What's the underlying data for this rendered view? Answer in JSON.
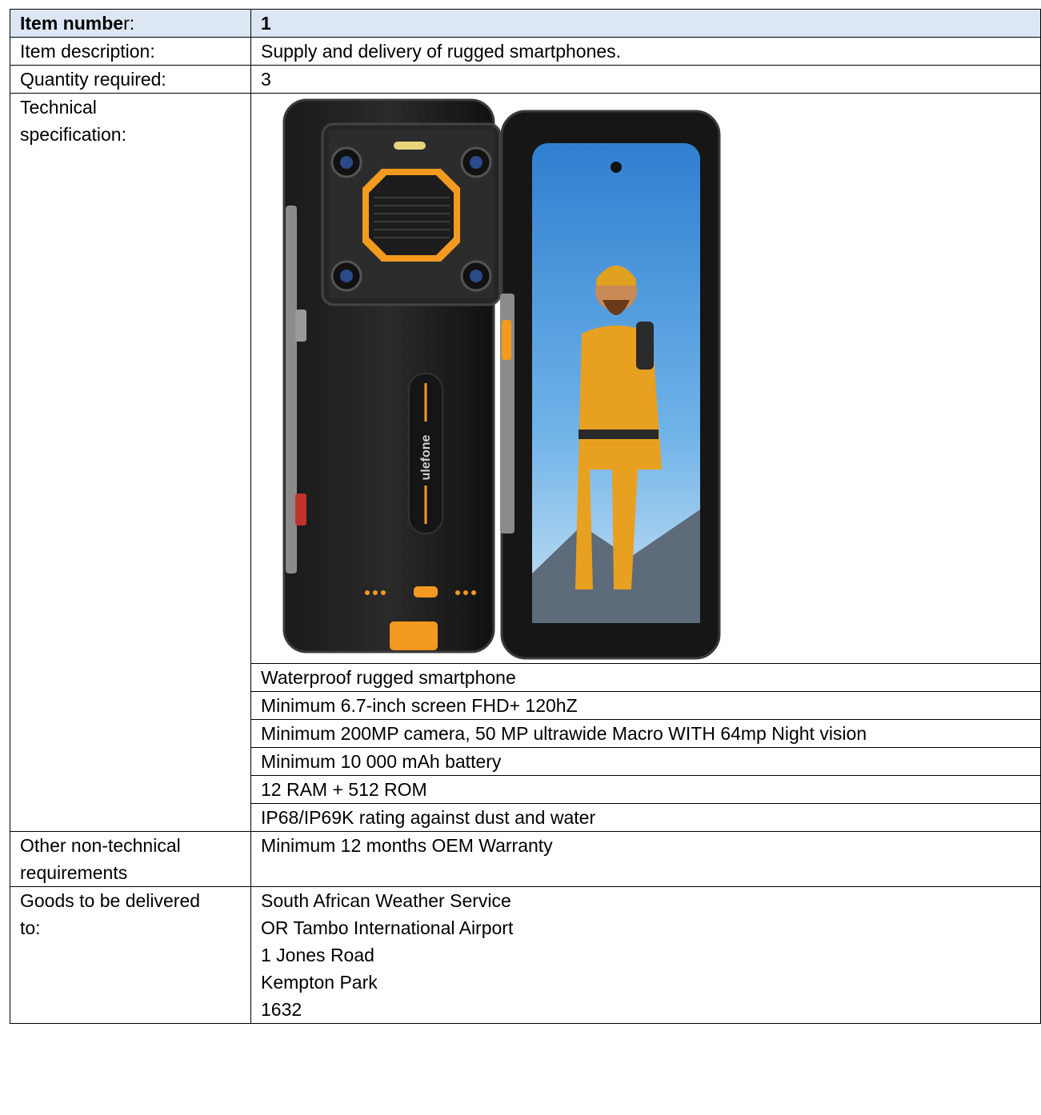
{
  "rows": {
    "item_number": {
      "label_bold": "Item numbe",
      "label_rest": "r:",
      "value": "1"
    },
    "item_description": {
      "label": "Item description:",
      "value": "Supply and delivery of rugged smartphones."
    },
    "quantity": {
      "label": "Quantity required:",
      "value": "3"
    },
    "technical": {
      "label_line1": "Technical",
      "label_line2": "specification:",
      "image": {
        "brand_text": "ulefone"
      },
      "specs": [
        "Waterproof rugged smartphone",
        "Minimum 6.7-inch screen FHD+ 120hZ",
        "Minimum 200MP camera, 50 MP ultrawide Macro WITH 64mp Night vision",
        "Minimum 10 000 mAh battery",
        "12 RAM + 512 ROM",
        "IP68/IP69K rating against dust and water"
      ]
    },
    "other": {
      "label_line1": "Other non-technical",
      "label_line2": "requirements",
      "value": "Minimum 12 months OEM Warranty"
    },
    "delivery": {
      "label_line1": "Goods to be delivered",
      "label_line2": "to:",
      "address": [
        "South African Weather Service",
        "OR Tambo International Airport",
        "1 Jones Road",
        "Kempton Park",
        "1632"
      ]
    }
  },
  "colors": {
    "header_bg": "#dde7f4",
    "accent_orange": "#f39a1f",
    "sky_blue": "#3f8fd6",
    "jacket_yellow": "#e8a020"
  }
}
